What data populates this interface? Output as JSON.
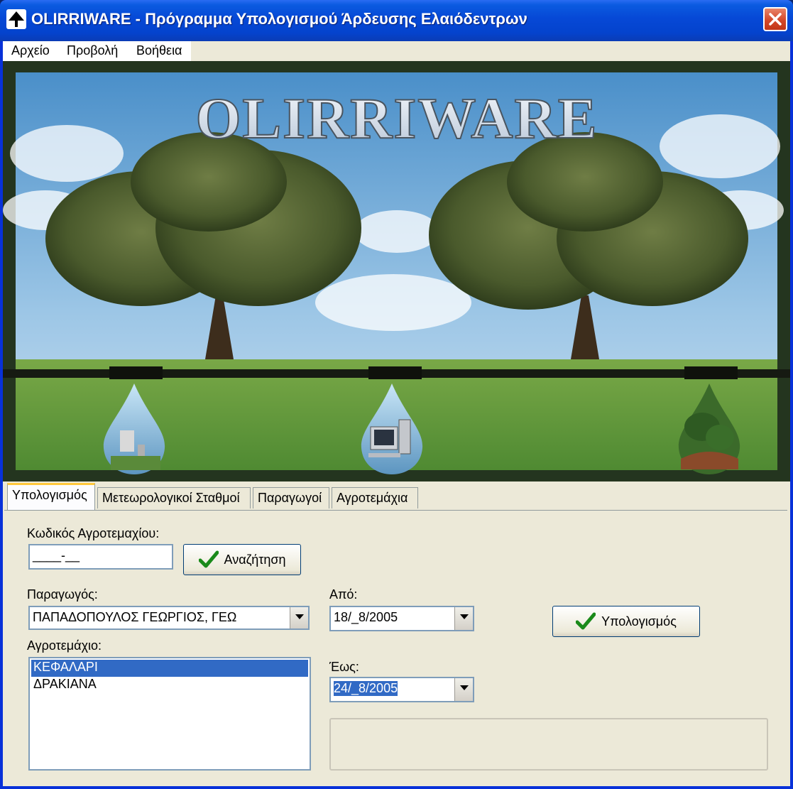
{
  "window": {
    "title": "OLIRRIWARE - Πρόγραμμα Υπολογισμού Άρδευσης Ελαιόδεντρων"
  },
  "menu": {
    "items": [
      "Αρχείο",
      "Προβολή",
      "Βοήθεια"
    ]
  },
  "banner": {
    "logo_text": "OLIRRIWARE"
  },
  "tabs": [
    "Υπολογισμός",
    "Μετεωρολογικοί Σταθμοί",
    "Παραγωγοί",
    "Αγροτεμάχια"
  ],
  "form": {
    "plot_code_label": "Κωδικός Αγροτεμαχίου:",
    "plot_code_value": "____-__",
    "search_button": "Αναζήτηση",
    "producer_label": "Παραγωγός:",
    "producer_value": "ΠΑΠΑΔΟΠΟΥΛΟΣ ΓΕΩΡΓΙΟΣ, ΓΕΩ",
    "plot_label": "Αγροτεμάχιο:",
    "plots": [
      "ΚΕΦΑΛΑΡΙ",
      "ΔΡΑΚΙΑΝΑ"
    ],
    "from_label": "Από:",
    "from_value": "18/_8/2005",
    "to_label": "Έως:",
    "to_value": "24/_8/2005",
    "calculate_button": "Υπολογισμός"
  }
}
